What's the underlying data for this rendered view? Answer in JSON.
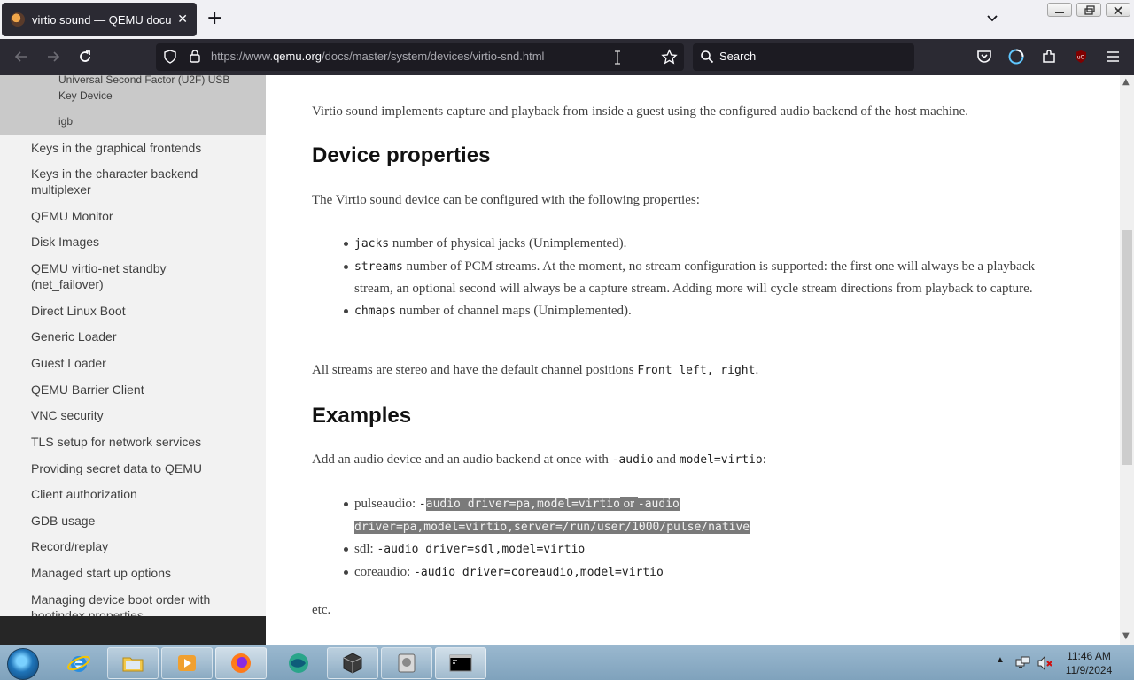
{
  "browser": {
    "tab_title": "virtio sound — QEMU documentation",
    "tab_close": "✕",
    "new_tab": "+",
    "url_prefix": "https://www.",
    "url_domain": "qemu.org",
    "url_path": "/docs/master/system/devices/virtio-snd.html",
    "search_placeholder": "Search"
  },
  "sidebar": {
    "sub_items": [
      "Universal Second Factor (U2F) USB Key Device",
      "igb"
    ],
    "items": [
      "Keys in the graphical frontends",
      "Keys in the character backend multiplexer",
      "QEMU Monitor",
      "Disk Images",
      "QEMU virtio-net standby (net_failover)",
      "Direct Linux Boot",
      "Generic Loader",
      "Guest Loader",
      "QEMU Barrier Client",
      "VNC security",
      "TLS setup for network services",
      "Providing secret data to QEMU",
      "Client authorization",
      "GDB usage",
      "Record/replay",
      "Managed start up options",
      "Managing device boot order with bootindex properties"
    ]
  },
  "content": {
    "intro": "Virtio sound implements capture and playback from inside a guest using the configured audio backend of the host machine.",
    "h_properties": "Device properties",
    "props_intro": "The Virtio sound device can be configured with the following properties:",
    "props": [
      {
        "code": "jacks",
        "text": " number of physical jacks (Unimplemented)."
      },
      {
        "code": "streams",
        "text": " number of PCM streams. At the moment, no stream configuration is supported: the first one will always be a playback stream, an optional second will always be a capture stream. Adding more will cycle stream directions from playback to capture."
      },
      {
        "code": "chmaps",
        "text": " number of channel maps (Unimplemented)."
      }
    ],
    "streams_text": "All streams are stereo and have the default channel positions ",
    "streams_code": "Front left, right",
    "streams_end": ".",
    "h_examples": "Examples",
    "ex_intro_a": "Add an audio device and an audio backend at once with ",
    "ex_intro_code1": "-audio",
    "ex_intro_b": " and ",
    "ex_intro_code2": "model=virtio",
    "ex_intro_c": ":",
    "examples": {
      "pulse_label": "pulseaudio",
      "pulse_sep": ": ",
      "pulse_code1_a": "-",
      "pulse_code1_b": "audio driver=pa,model=virtio",
      "pulse_or": " or ",
      "pulse_code2": "-audio driver=pa,model=virtio,server=/run/user/1000/pulse/native",
      "sdl_label": "sdl",
      "sdl_sep": ": ",
      "sdl_code": "-audio driver=sdl,model=virtio",
      "core_label": "coreaudio",
      "core_sep": ": ",
      "core_code": "-audio driver=coreaudio,model=virtio"
    },
    "etc": "etc."
  },
  "taskbar": {
    "time": "11:46 AM",
    "date": "11/9/2024"
  }
}
